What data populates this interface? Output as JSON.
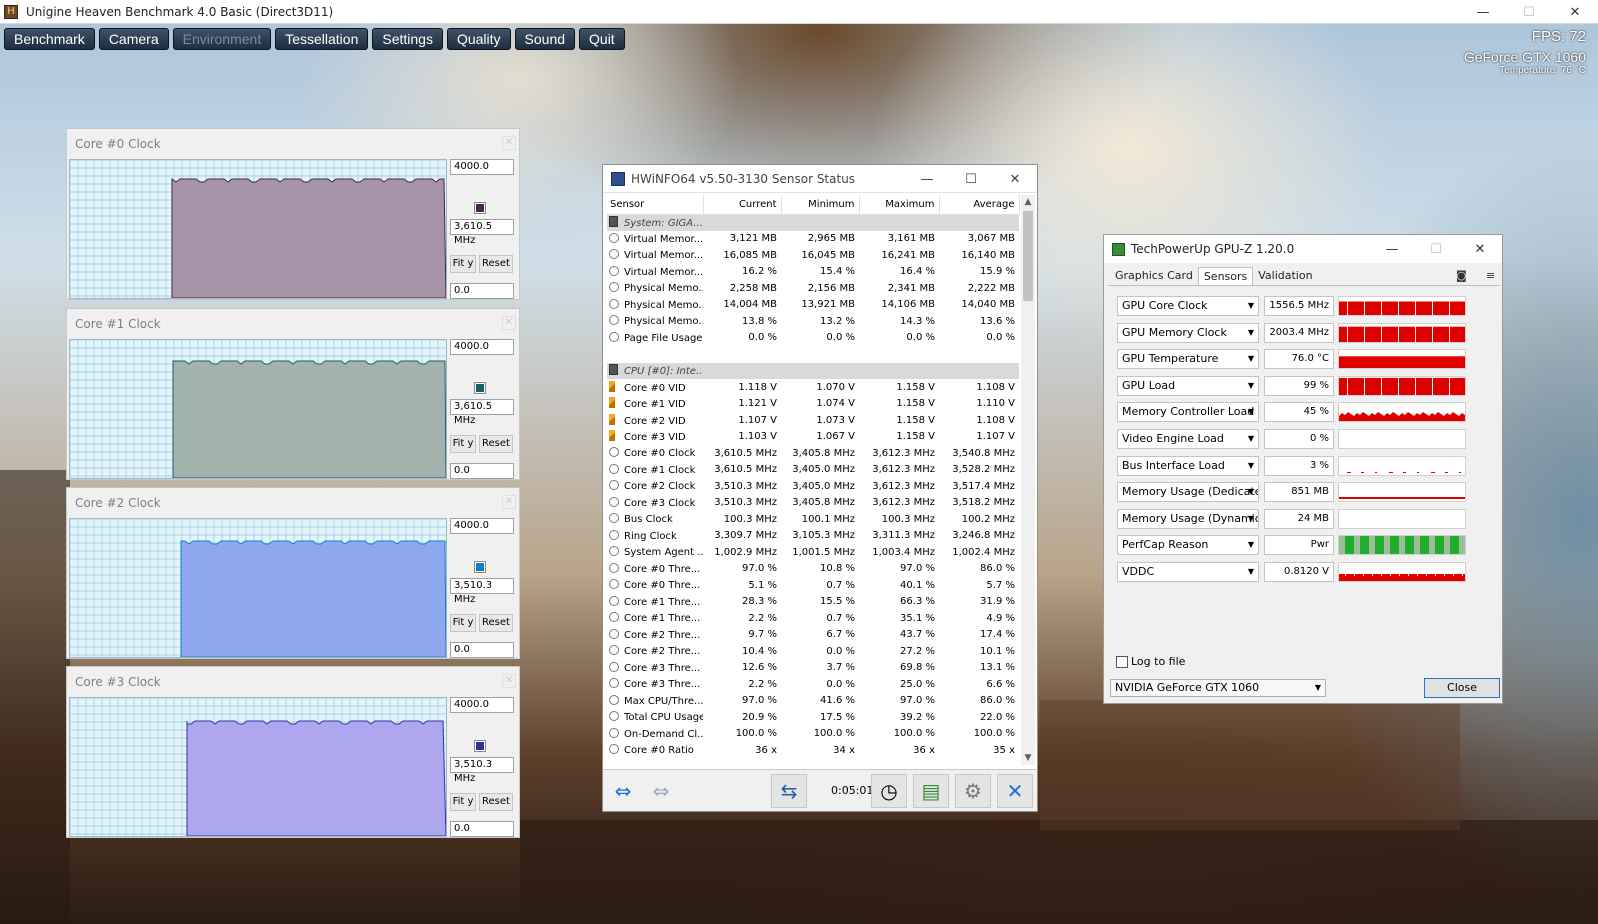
{
  "app": {
    "title": "Unigine Heaven Benchmark 4.0 Basic (Direct3D11)",
    "menu": [
      {
        "label": "Benchmark",
        "enabled": true
      },
      {
        "label": "Camera",
        "enabled": true
      },
      {
        "label": "Environment",
        "enabled": false
      },
      {
        "label": "Tessellation",
        "enabled": true
      },
      {
        "label": "Settings",
        "enabled": true
      },
      {
        "label": "Quality",
        "enabled": true
      },
      {
        "label": "Sound",
        "enabled": true
      },
      {
        "label": "Quit",
        "enabled": true
      }
    ],
    "fps": "FPS: 72",
    "gpu": "GeForce GTX 1060",
    "temp": "Temperature: 76 °C",
    "window_controls": {
      "minimize": "—",
      "maximize": "☐",
      "close": "✕"
    }
  },
  "core_panels": [
    {
      "title": "Core #0 Clock",
      "max": "4000.0",
      "current": "3,610.5 MHz",
      "min": "0.0",
      "fit": "Fit y",
      "reset": "Reset",
      "color": "#a694a8",
      "line": "#4a2050",
      "start": 0.27,
      "level": 0.86
    },
    {
      "title": "Core #1 Clock",
      "max": "4000.0",
      "current": "3,610.5 MHz",
      "min": "0.0",
      "fit": "Fit y",
      "reset": "Reset",
      "color": "#a3b2ad",
      "line": "#1a6060",
      "start": 0.275,
      "level": 0.85
    },
    {
      "title": "Core #2 Clock",
      "max": "4000.0",
      "current": "3,510.3 MHz",
      "min": "0.0",
      "fit": "Fit y",
      "reset": "Reset",
      "color": "#8ea8ef",
      "line": "#1080c0",
      "start": 0.295,
      "level": 0.84
    },
    {
      "title": "Core #3 Clock",
      "max": "4000.0",
      "current": "3,510.3 MHz",
      "min": "0.0",
      "fit": "Fit y",
      "reset": "Reset",
      "color": "#aea6ef",
      "line": "#3030a0",
      "start": 0.31,
      "level": 0.83
    }
  ],
  "hwinfo": {
    "title": "HWiNFO64 v5.50-3130 Sensor Status",
    "headers": [
      "Sensor",
      "Current",
      "Minimum",
      "Maximum",
      "Average"
    ],
    "timer": "0:05:01",
    "rows": [
      {
        "g": true,
        "icon": "chip",
        "c": [
          "System: GIGA...",
          "",
          "",
          "",
          ""
        ]
      },
      {
        "icon": "circle",
        "c": [
          "Virtual Memor...",
          "3,121 MB",
          "2,965 MB",
          "3,161 MB",
          "3,067 MB"
        ]
      },
      {
        "icon": "circle",
        "c": [
          "Virtual Memor...",
          "16,085 MB",
          "16,045 MB",
          "16,241 MB",
          "16,140 MB"
        ]
      },
      {
        "icon": "circle",
        "c": [
          "Virtual Memor...",
          "16.2 %",
          "15.4 %",
          "16.4 %",
          "15.9 %"
        ]
      },
      {
        "icon": "circle",
        "c": [
          "Physical Memo...",
          "2,258 MB",
          "2,156 MB",
          "2,341 MB",
          "2,222 MB"
        ]
      },
      {
        "icon": "circle",
        "c": [
          "Physical Memo...",
          "14,004 MB",
          "13,921 MB",
          "14,106 MB",
          "14,040 MB"
        ]
      },
      {
        "icon": "circle",
        "c": [
          "Physical Memo...",
          "13.8 %",
          "13.2 %",
          "14.3 %",
          "13.6 %"
        ]
      },
      {
        "icon": "circle",
        "c": [
          "Page File Usage",
          "0.0 %",
          "0.0 %",
          "0.0 %",
          "0.0 %"
        ]
      },
      {
        "icon": "none",
        "c": [
          "",
          "",
          "",
          "",
          ""
        ]
      },
      {
        "g": true,
        "icon": "chip",
        "c": [
          "CPU [#0]: Inte...",
          "",
          "",
          "",
          ""
        ]
      },
      {
        "icon": "bolt",
        "c": [
          "Core #0 VID",
          "1.118 V",
          "1.070 V",
          "1.158 V",
          "1.108 V"
        ]
      },
      {
        "icon": "bolt",
        "c": [
          "Core #1 VID",
          "1.121 V",
          "1.074 V",
          "1.158 V",
          "1.110 V"
        ]
      },
      {
        "icon": "bolt",
        "c": [
          "Core #2 VID",
          "1.107 V",
          "1.073 V",
          "1.158 V",
          "1.108 V"
        ]
      },
      {
        "icon": "bolt",
        "c": [
          "Core #3 VID",
          "1.103 V",
          "1.067 V",
          "1.158 V",
          "1.107 V"
        ]
      },
      {
        "icon": "circle",
        "c": [
          "Core #0 Clock",
          "3,610.5 MHz",
          "3,405.8 MHz",
          "3,612.3 MHz",
          "3,540.8 MHz"
        ]
      },
      {
        "icon": "circle",
        "c": [
          "Core #1 Clock",
          "3,610.5 MHz",
          "3,405.0 MHz",
          "3,612.3 MHz",
          "3,528.2 MHz"
        ]
      },
      {
        "icon": "circle",
        "c": [
          "Core #2 Clock",
          "3,510.3 MHz",
          "3,405.0 MHz",
          "3,612.3 MHz",
          "3,517.4 MHz"
        ]
      },
      {
        "icon": "circle",
        "c": [
          "Core #3 Clock",
          "3,510.3 MHz",
          "3,405.8 MHz",
          "3,612.3 MHz",
          "3,518.2 MHz"
        ]
      },
      {
        "icon": "circle",
        "c": [
          "Bus Clock",
          "100.3 MHz",
          "100.1 MHz",
          "100.3 MHz",
          "100.2 MHz"
        ]
      },
      {
        "icon": "circle",
        "c": [
          "Ring Clock",
          "3,309.7 MHz",
          "3,105.3 MHz",
          "3,311.3 MHz",
          "3,246.8 MHz"
        ]
      },
      {
        "icon": "circle",
        "c": [
          "System Agent ...",
          "1,002.9 MHz",
          "1,001.5 MHz",
          "1,003.4 MHz",
          "1,002.4 MHz"
        ]
      },
      {
        "icon": "circle",
        "c": [
          "Core #0 Thre...",
          "97.0 %",
          "10.8 %",
          "97.0 %",
          "86.0 %"
        ]
      },
      {
        "icon": "circle",
        "c": [
          "Core #0 Thre...",
          "5.1 %",
          "0.7 %",
          "40.1 %",
          "5.7 %"
        ]
      },
      {
        "icon": "circle",
        "c": [
          "Core #1 Thre...",
          "28.3 %",
          "15.5 %",
          "66.3 %",
          "31.9 %"
        ]
      },
      {
        "icon": "circle",
        "c": [
          "Core #1 Thre...",
          "2.2 %",
          "0.7 %",
          "35.1 %",
          "4.9 %"
        ]
      },
      {
        "icon": "circle",
        "c": [
          "Core #2 Thre...",
          "9.7 %",
          "6.7 %",
          "43.7 %",
          "17.4 %"
        ]
      },
      {
        "icon": "circle",
        "c": [
          "Core #2 Thre...",
          "10.4 %",
          "0.0 %",
          "27.2 %",
          "10.1 %"
        ]
      },
      {
        "icon": "circle",
        "c": [
          "Core #3 Thre...",
          "12.6 %",
          "3.7 %",
          "69.8 %",
          "13.1 %"
        ]
      },
      {
        "icon": "circle",
        "c": [
          "Core #3 Thre...",
          "2.2 %",
          "0.0 %",
          "25.0 %",
          "6.6 %"
        ]
      },
      {
        "icon": "circle",
        "c": [
          "Max CPU/Thre...",
          "97.0 %",
          "41.6 %",
          "97.0 %",
          "86.0 %"
        ]
      },
      {
        "icon": "circle",
        "c": [
          "Total CPU Usage",
          "20.9 %",
          "17.5 %",
          "39.2 %",
          "22.0 %"
        ]
      },
      {
        "icon": "circle",
        "c": [
          "On-Demand Cl...",
          "100.0 %",
          "100.0 %",
          "100.0 %",
          "100.0 %"
        ]
      },
      {
        "icon": "circle",
        "c": [
          "Core #0 Ratio",
          "36 x",
          "34 x",
          "36 x",
          "35 x"
        ]
      }
    ]
  },
  "gpuz": {
    "title": "TechPowerUp GPU-Z 1.20.0",
    "tabs": [
      "Graphics Card",
      "Sensors",
      "Validation"
    ],
    "active_tab": 1,
    "sensors": [
      {
        "name": "GPU Core Clock",
        "value": "1556.5 MHz",
        "graph": "busy",
        "level": 0.75
      },
      {
        "name": "GPU Memory Clock",
        "value": "2003.4 MHz",
        "graph": "busy",
        "level": 0.85
      },
      {
        "name": "GPU Temperature",
        "value": "76.0 °C",
        "graph": "full",
        "level": 0.65
      },
      {
        "name": "GPU Load",
        "value": "99 %",
        "graph": "busy",
        "level": 0.95
      },
      {
        "name": "Memory Controller Load",
        "value": "45 %",
        "graph": "mid",
        "level": 0.45
      },
      {
        "name": "Video Engine Load",
        "value": "0 %",
        "graph": "none",
        "level": 0
      },
      {
        "name": "Bus Interface Load",
        "value": "3 %",
        "graph": "dash",
        "level": 0.03
      },
      {
        "name": "Memory Usage (Dedicated)",
        "value": "851 MB",
        "graph": "line",
        "level": 0.15
      },
      {
        "name": "Memory Usage (Dynamic)",
        "value": "24 MB",
        "graph": "none",
        "level": 0
      },
      {
        "name": "PerfCap Reason",
        "value": "Pwr",
        "graph": "perfcap",
        "level": 1
      },
      {
        "name": "VDDC",
        "value": "0.8120 V",
        "graph": "low",
        "level": 0.4
      }
    ],
    "log_label": "Log to file",
    "gpu_select": "NVIDIA GeForce GTX 1060",
    "close_label": "Close"
  }
}
